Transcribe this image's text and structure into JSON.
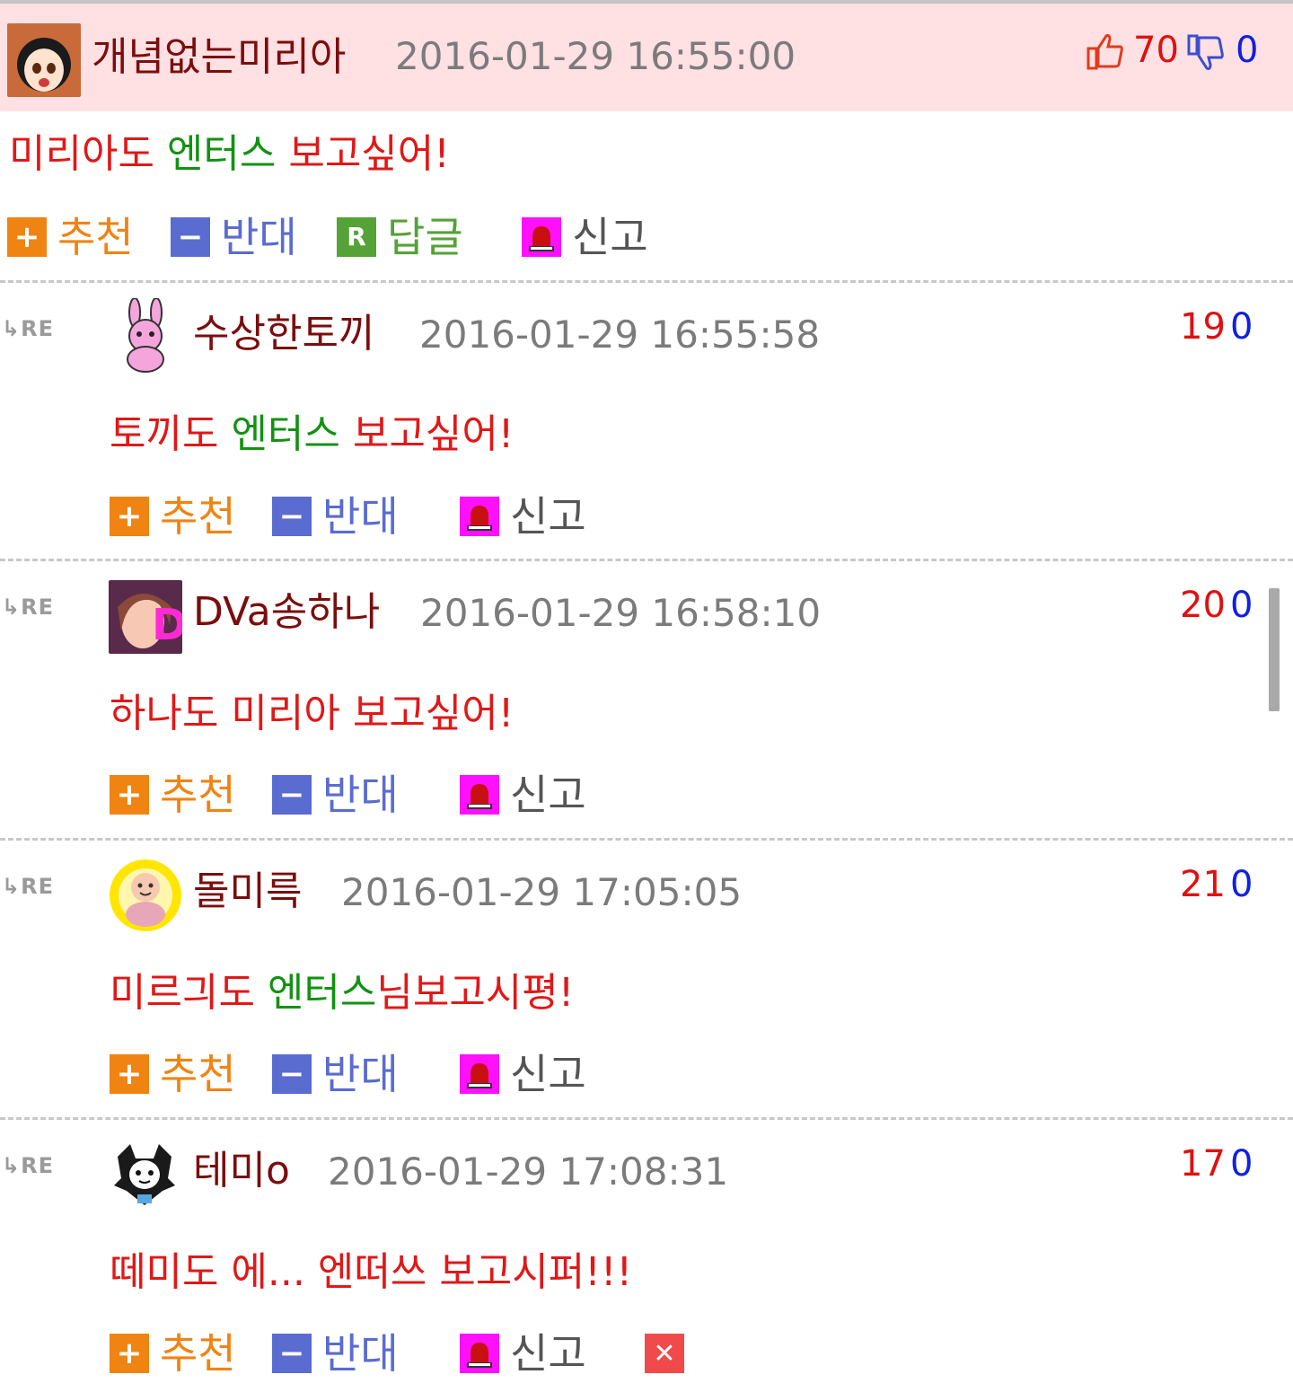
{
  "main_comment": {
    "username": "개념없는미리아",
    "timestamp": "2016-01-29 16:55:00",
    "upvotes": "70",
    "downvotes": "0",
    "body": [
      {
        "text": "미리아도 ",
        "color": "#e01818"
      },
      {
        "text": "엔터스",
        "color": "#129212"
      },
      {
        "text": " 보고싶어!",
        "color": "#e01818"
      }
    ],
    "actions": {
      "recommend": "추천",
      "oppose": "반대",
      "reply": "답글",
      "report": "신고"
    }
  },
  "re_label": "RE",
  "replies": [
    {
      "username": "수상한토끼",
      "timestamp": "2016-01-29 16:55:58",
      "upvotes": "19",
      "downvotes": "0",
      "body": [
        {
          "text": "토끼도 ",
          "color": "#e01818"
        },
        {
          "text": "엔터스",
          "color": "#129212"
        },
        {
          "text": " 보고싶어!",
          "color": "#e01818"
        }
      ],
      "actions": {
        "recommend": "추천",
        "oppose": "반대",
        "report": "신고"
      }
    },
    {
      "username": "DVa송하나",
      "timestamp": "2016-01-29 16:58:10",
      "upvotes": "20",
      "downvotes": "0",
      "body": [
        {
          "text": "하나도 미리아 보고싶어!",
          "color": "#e01818"
        }
      ],
      "actions": {
        "recommend": "추천",
        "oppose": "반대",
        "report": "신고"
      }
    },
    {
      "username": "돌미륵",
      "timestamp": "2016-01-29 17:05:05",
      "upvotes": "21",
      "downvotes": "0",
      "body": [
        {
          "text": "미르긔도 ",
          "color": "#e01818"
        },
        {
          "text": "엔터스",
          "color": "#129212"
        },
        {
          "text": "님보고시평!",
          "color": "#e01818"
        }
      ],
      "actions": {
        "recommend": "추천",
        "oppose": "반대",
        "report": "신고"
      }
    },
    {
      "username": "테미o",
      "timestamp": "2016-01-29 17:08:31",
      "upvotes": "17",
      "downvotes": "0",
      "body": [
        {
          "text": "떼미도 에... 엔떠쓰 보고시퍼!!!",
          "color": "#e01818"
        }
      ],
      "actions": {
        "recommend": "추천",
        "oppose": "반대",
        "report": "신고"
      },
      "deletable": true
    }
  ],
  "colors": {
    "header_bg": "#ffe0e3",
    "username": "#7a0d0d",
    "upvote": "#e01010",
    "downvote": "#1020e0",
    "recommend": "#f08412",
    "oppose": "#5a6cd0",
    "reply": "#55a237",
    "report_icon": "#ff10ff"
  },
  "icons": [
    "thumbs-up-icon",
    "thumbs-down-icon",
    "plus-icon",
    "minus-icon",
    "reply-r-icon",
    "siren-icon",
    "delete-x-icon",
    "reply-arrow-icon"
  ]
}
